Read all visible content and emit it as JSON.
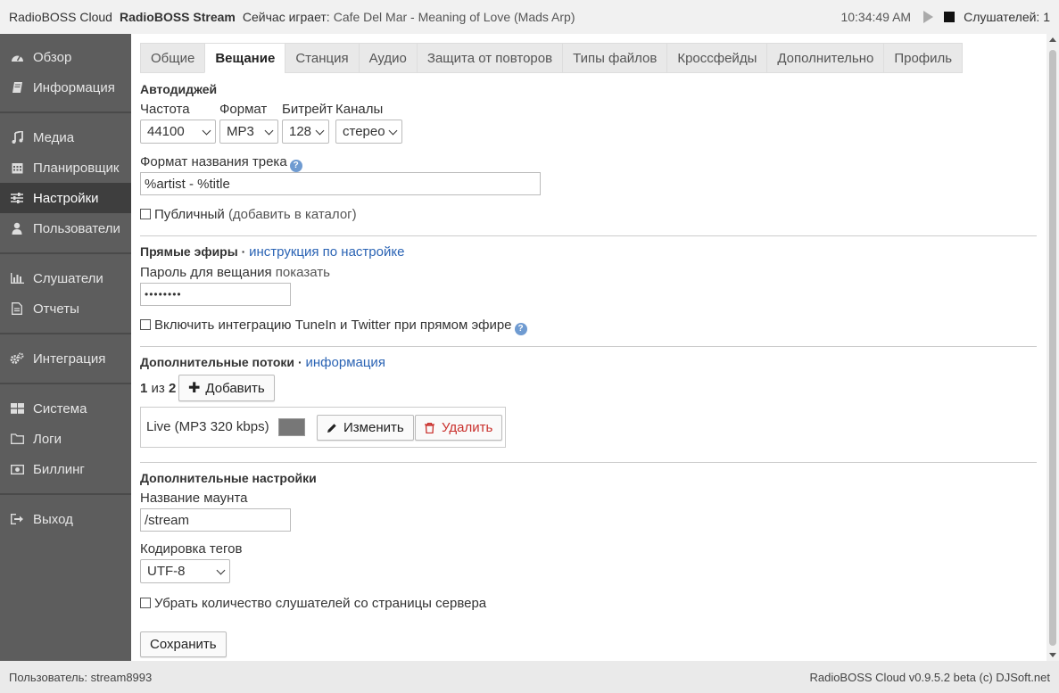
{
  "topbar": {
    "app_name": "RadioBOSS Cloud",
    "stream_name": "RadioBOSS Stream",
    "now_playing_label": "Сейчас играет:",
    "now_playing_track": "Cafe Del Mar - Meaning of Love (Mads Arp)",
    "time": "10:34:49 AM",
    "listeners_label": "Слушателей: 1"
  },
  "sidebar": {
    "items": [
      {
        "label": "Обзор",
        "icon": "dashboard-icon"
      },
      {
        "label": "Информация",
        "icon": "book-icon"
      },
      {
        "label": "Медиа",
        "icon": "music-icon"
      },
      {
        "label": "Планировщик",
        "icon": "calendar-icon"
      },
      {
        "label": "Настройки",
        "icon": "sliders-icon",
        "active": true
      },
      {
        "label": "Пользователи",
        "icon": "user-icon"
      },
      {
        "label": "Слушатели",
        "icon": "bar-chart-icon"
      },
      {
        "label": "Отчеты",
        "icon": "document-icon"
      },
      {
        "label": "Интеграция",
        "icon": "gears-icon"
      },
      {
        "label": "Система",
        "icon": "grid-icon"
      },
      {
        "label": "Логи",
        "icon": "folder-icon"
      },
      {
        "label": "Биллинг",
        "icon": "money-icon"
      },
      {
        "label": "Выход",
        "icon": "sign-out-icon"
      }
    ]
  },
  "tabs": [
    {
      "label": "Общие"
    },
    {
      "label": "Вещание",
      "active": true
    },
    {
      "label": "Станция"
    },
    {
      "label": "Аудио"
    },
    {
      "label": "Защита от повторов"
    },
    {
      "label": "Типы файлов"
    },
    {
      "label": "Кроссфейды"
    },
    {
      "label": "Дополнительно"
    },
    {
      "label": "Профиль"
    }
  ],
  "autodj": {
    "title": "Автодиджей",
    "freq_label": "Частота",
    "freq_value": "44100",
    "format_label": "Формат",
    "format_value": "MP3",
    "bitrate_label": "Битрейт",
    "bitrate_value": "128",
    "channels_label": "Каналы",
    "channels_value": "стерео",
    "track_format_label": "Формат названия трека",
    "track_format_value": "%artist - %title",
    "public_label": "Публичный",
    "public_note": "(добавить в каталог)"
  },
  "live": {
    "title": "Прямые эфиры",
    "separator": "·",
    "link": "инструкция по настройке",
    "password_label": "Пароль для вещания",
    "show_link": "показать",
    "password_value": "••••••••",
    "integration_label": "Включить интеграцию TuneIn и Twitter при прямом эфире"
  },
  "streams": {
    "title": "Дополнительные потоки",
    "separator": "·",
    "link": "информация",
    "count_current": "1",
    "count_of": "из",
    "count_total": "2",
    "add_label": "Добавить",
    "item_name": "Live (MP3 320 kbps)",
    "edit_label": "Изменить",
    "delete_label": "Удалить"
  },
  "extra": {
    "title": "Дополнительные настройки",
    "mount_label": "Название маунта",
    "mount_value": "/stream",
    "encoding_label": "Кодировка тегов",
    "encoding_value": "UTF-8",
    "hide_listeners_label": "Убрать количество слушателей со страницы сервера",
    "save_label": "Сохранить"
  },
  "footer": {
    "user": "Пользователь: stream8993",
    "version": "RadioBOSS Cloud v0.9.5.2 beta (c) DJSoft.net"
  },
  "colors": {
    "sidebar_bg": "#5d5d5d",
    "sidebar_active": "#3e3e3e",
    "link": "#2a63b4",
    "danger": "#c9302c"
  }
}
